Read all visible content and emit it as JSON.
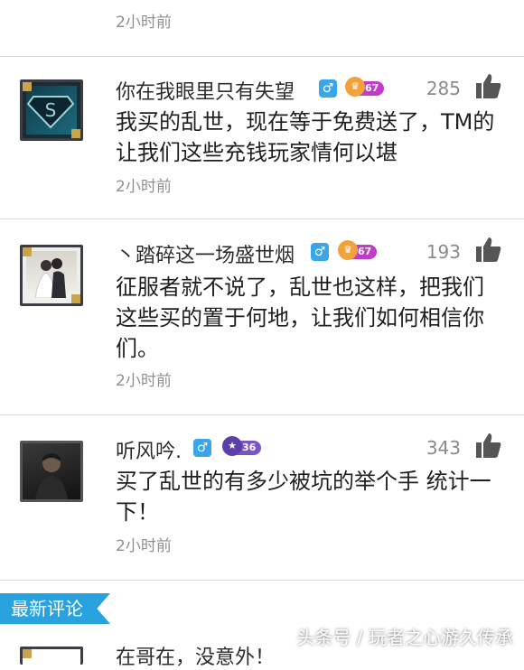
{
  "top_time": "2小时前",
  "comments": [
    {
      "username": "你在我眼里只有失望",
      "level": "67",
      "likes": "285",
      "content": "我买的乱世，现在等于免费送了，TM的 让我们这些充钱玩家情何以堪",
      "time": "2小时前",
      "avatar_icon": "superman-logo"
    },
    {
      "username": "丶踏碎这一场盛世烟",
      "level": "67",
      "likes": "193",
      "content": "征服者就不说了，乱世也这样，把我们这些买的置于何地，让我们如何相信你们。",
      "time": "2小时前",
      "avatar_icon": "wedding-photo"
    },
    {
      "username": "听风吟.",
      "level": "36",
      "likes": "343",
      "content": "买了乱世的有多少被坑的举个手 统计一下！",
      "time": "2小时前",
      "avatar_icon": "person-photo"
    }
  ],
  "section_label": "最新评论",
  "partial_comment": "在哥在，没意外！",
  "watermark": "头条号 / 玩者之心游久传承",
  "colors": {
    "gender_male": "#3aa5e8",
    "level_high": "#c23cc8",
    "level_mid": "#7a55c7",
    "section_accent": "#29a3e0"
  }
}
